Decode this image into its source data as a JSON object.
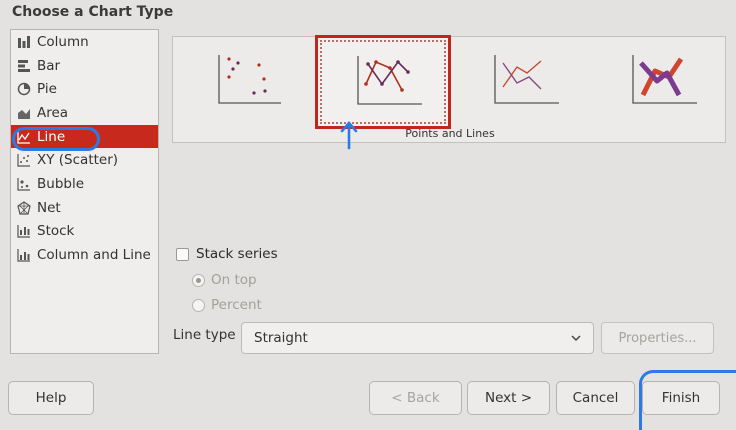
{
  "dialog": {
    "title": "Choose a Chart Type"
  },
  "chart_types": [
    {
      "label": "Column",
      "icon": "column-chart-icon"
    },
    {
      "label": "Bar",
      "icon": "bar-chart-icon"
    },
    {
      "label": "Pie",
      "icon": "pie-chart-icon"
    },
    {
      "label": "Area",
      "icon": "area-chart-icon"
    },
    {
      "label": "Line",
      "icon": "line-chart-icon",
      "selected": true
    },
    {
      "label": "XY (Scatter)",
      "icon": "scatter-chart-icon"
    },
    {
      "label": "Bubble",
      "icon": "bubble-chart-icon"
    },
    {
      "label": "Net",
      "icon": "net-chart-icon"
    },
    {
      "label": "Stock",
      "icon": "stock-chart-icon"
    },
    {
      "label": "Column and Line",
      "icon": "column-line-chart-icon"
    }
  ],
  "variants": {
    "selected_caption": "Points and Lines",
    "items": [
      "points-only",
      "points-and-lines",
      "lines-only",
      "3d-lines"
    ]
  },
  "options": {
    "stack_series": "Stack series",
    "on_top": "On top",
    "percent": "Percent",
    "line_type_label": "Line type",
    "line_type_value": "Straight",
    "properties": "Properties..."
  },
  "buttons": {
    "help": "Help",
    "back": "< Back",
    "next": "Next >",
    "cancel": "Cancel",
    "finish": "Finish"
  },
  "colors": {
    "selection": "#c72a1c",
    "annotation": "#2c7be5"
  }
}
